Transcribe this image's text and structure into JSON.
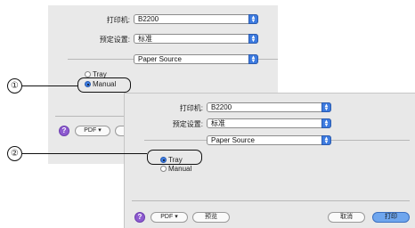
{
  "back_dialog": {
    "printer_label": "打印机:",
    "printer_value": "B2200",
    "preset_label": "预定设置:",
    "preset_value": "标准",
    "section_value": "Paper Source",
    "radio_tray": "Tray",
    "radio_manual": "Manual",
    "pdf_label": "PDF ▾"
  },
  "front_dialog": {
    "printer_label": "打印机:",
    "printer_value": "B2200",
    "preset_label": "预定设置:",
    "preset_value": "标准",
    "section_value": "Paper Source",
    "radio_tray": "Tray",
    "radio_manual": "Manual",
    "help_label": "?",
    "pdf_label": "PDF ▾",
    "preview_label": "预览",
    "cancel_label": "取消",
    "print_label": "打印"
  },
  "callouts": {
    "one": "①",
    "two": "②"
  },
  "selected": {
    "back": "Manual",
    "front": "Tray"
  }
}
